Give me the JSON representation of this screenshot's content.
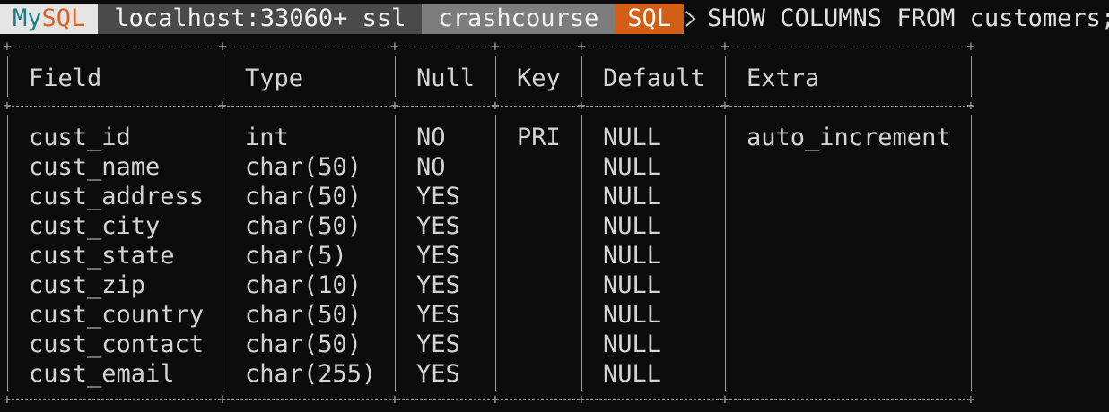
{
  "prompt": {
    "app_my": "My",
    "app_sql": "SQL",
    "connection": "localhost:33060+ ssl",
    "schema": "crashcourse",
    "mode": "SQL",
    "command": "SHOW COLUMNS FROM customers;"
  },
  "table": {
    "headers": [
      "Field",
      "Type",
      "Null",
      "Key",
      "Default",
      "Extra"
    ],
    "rows": [
      [
        "cust_id",
        "int",
        "NO",
        "PRI",
        "NULL",
        "auto_increment"
      ],
      [
        "cust_name",
        "char(50)",
        "NO",
        "",
        "NULL",
        ""
      ],
      [
        "cust_address",
        "char(50)",
        "YES",
        "",
        "NULL",
        ""
      ],
      [
        "cust_city",
        "char(50)",
        "YES",
        "",
        "NULL",
        ""
      ],
      [
        "cust_state",
        "char(5)",
        "YES",
        "",
        "NULL",
        ""
      ],
      [
        "cust_zip",
        "char(10)",
        "YES",
        "",
        "NULL",
        ""
      ],
      [
        "cust_country",
        "char(50)",
        "YES",
        "",
        "NULL",
        ""
      ],
      [
        "cust_contact",
        "char(50)",
        "YES",
        "",
        "NULL",
        ""
      ],
      [
        "cust_email",
        "char(255)",
        "YES",
        "",
        "NULL",
        ""
      ]
    ]
  },
  "colors": {
    "background": "#0c0c0c",
    "mysql_my": "#1a7c86",
    "mysql_sql": "#d8612a",
    "mode_bg": "#d35f16"
  }
}
